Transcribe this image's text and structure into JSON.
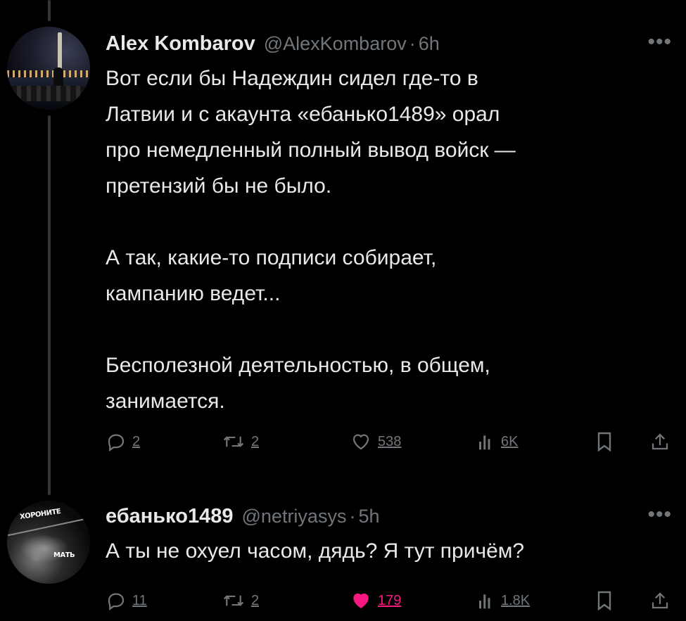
{
  "tweets": [
    {
      "author_name": "Alex Kombarov",
      "handle": "@AlexKombarov",
      "separator": "·",
      "time": "6h",
      "more": "•••",
      "paragraphs": [
        [
          "Вот если бы Надеждин сидел где-то в",
          "Латвии и с акаунта «ебанько1489» орал",
          "про немедленный полный вывод войск —",
          "претензий бы не было."
        ],
        [
          "А так, какие-то подписи собирает,",
          "кампанию ведет..."
        ],
        [
          "Бесполезной деятельностью, в общем,",
          "занимается."
        ]
      ],
      "stats": {
        "replies": "2",
        "reposts": "2",
        "likes": "538",
        "views": "6K"
      },
      "liked": false
    },
    {
      "author_name": "ебанько1489",
      "handle": "@netriyasys",
      "separator": "·",
      "time": "5h",
      "more": "•••",
      "avatar_text": [
        "ХОРОНИТЕ",
        "МАТЬ"
      ],
      "paragraphs": [
        [
          "А ты не охуел часом, дядь? Я тут причём?"
        ]
      ],
      "stats": {
        "replies": "11",
        "reposts": "2",
        "likes": "179",
        "views": "1.8K"
      },
      "liked": true
    }
  ],
  "icons": {
    "reply": "reply-icon",
    "repost": "repost-icon",
    "like": "heart-icon",
    "views": "views-icon",
    "bookmark": "bookmark-icon",
    "share": "share-icon"
  },
  "colors": {
    "background": "#000000",
    "text": "#e7e9ea",
    "secondary": "#71767b",
    "like": "#f91880",
    "thread_line": "#333639"
  }
}
